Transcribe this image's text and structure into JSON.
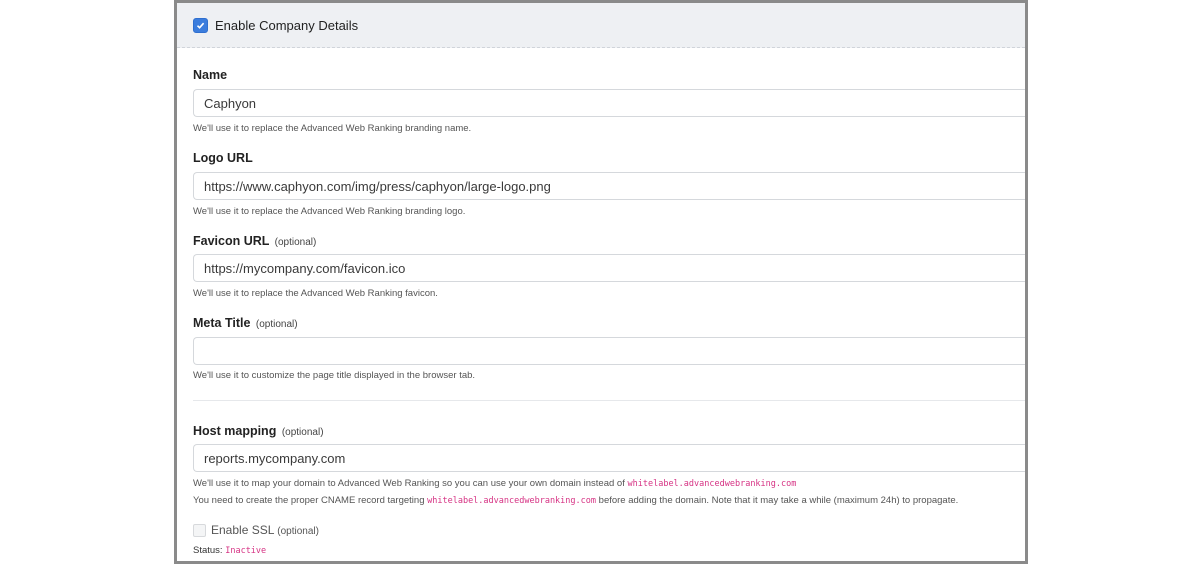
{
  "header": {
    "enable_label": "Enable Company Details",
    "checked": true
  },
  "fields": {
    "name": {
      "label": "Name",
      "value": "Caphyon",
      "help": "We'll use it to replace the Advanced Web Ranking branding name."
    },
    "logo": {
      "label": "Logo URL",
      "value": "https://www.caphyon.com/img/press/caphyon/large-logo.png",
      "help": "We'll use it to replace the Advanced Web Ranking branding logo."
    },
    "favicon": {
      "label": "Favicon URL",
      "optional": "(optional)",
      "value": "https://mycompany.com/favicon.ico",
      "help": "We'll use it to replace the Advanced Web Ranking favicon."
    },
    "meta": {
      "label": "Meta Title",
      "optional": "(optional)",
      "value": "",
      "help": "We'll use it to customize the page title displayed in the browser tab."
    },
    "host": {
      "label": "Host mapping",
      "optional": "(optional)",
      "value": "reports.mycompany.com",
      "help1_pre": "We'll use it to map your domain to Advanced Web Ranking so you can use your own domain instead of",
      "help1_code": "whitelabel.advancedwebranking.com",
      "help2_pre": "You need to create the proper CNAME record targeting",
      "help2_code": "whitelabel.advancedwebranking.com",
      "help2_post": "before adding the domain. Note that it may take a while (maximum 24h) to propagate."
    }
  },
  "ssl": {
    "label": "Enable SSL",
    "optional": "(optional)",
    "checked": false,
    "status_label": "Status:",
    "status_value": "Inactive"
  }
}
